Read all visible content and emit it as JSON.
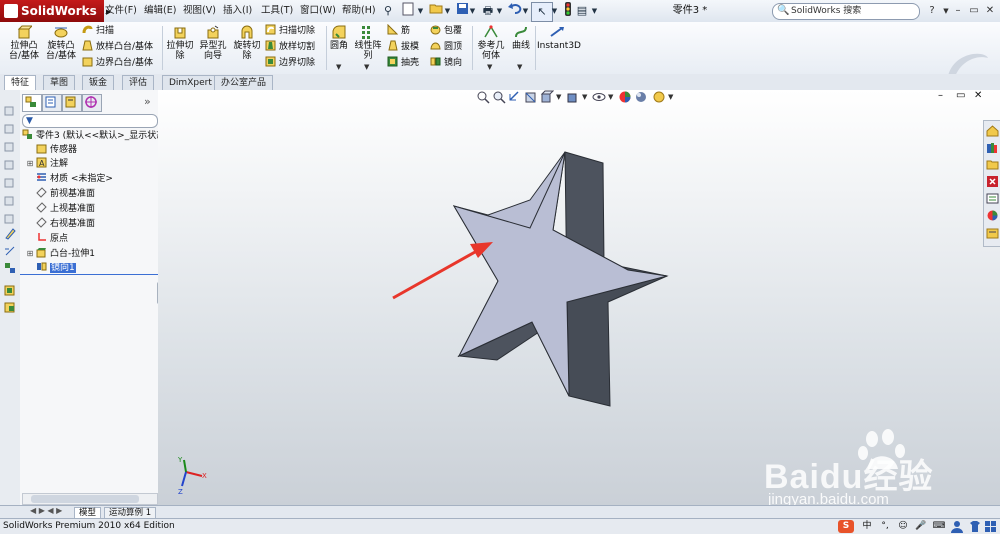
{
  "app": {
    "logo": "SolidWorks",
    "document_title": "零件3 *"
  },
  "menu": [
    "文件(F)",
    "编辑(E)",
    "视图(V)",
    "插入(I)",
    "工具(T)",
    "窗口(W)",
    "帮助(H)"
  ],
  "search": {
    "text": "SolidWorks 搜索"
  },
  "window_buttons": {
    "help": "?",
    "minimize": "–",
    "restore": "▭",
    "close": "✕"
  },
  "features_toolbar": {
    "extrude_boss": "拉伸凸\n台/基体",
    "revolve_boss": "旋转凸\n台/基体",
    "sweep": "扫描",
    "loft_boss": "放样凸台/基体",
    "boundary_boss": "边界凸台/基体",
    "extrude_cut": "拉伸切\n除",
    "hole_wizard": "异型孔\n向导",
    "revolve_cut": "旋转切\n除",
    "sweep_cut": "扫描切除",
    "loft_cut": "放样切割",
    "boundary_cut": "边界切除",
    "fillet": "圆角",
    "linear_pattern": "线性阵\n列",
    "rib": "筋",
    "draft": "拔模",
    "shell": "抽壳",
    "wrap": "包覆",
    "dome": "圆顶",
    "mirror": "镜向",
    "reference_geometry": "参考几\n何体",
    "curves": "曲线",
    "instant3d": "Instant3D"
  },
  "tabs": [
    {
      "label": "特征",
      "active": true
    },
    {
      "label": "草图",
      "active": false
    },
    {
      "label": "钣金",
      "active": false
    },
    {
      "label": "评估",
      "active": false
    },
    {
      "label": "DimXpert",
      "active": false
    },
    {
      "label": "办公室产品",
      "active": false
    }
  ],
  "feature_tree": {
    "root": "零件3 (默认<<默认>_显示状态",
    "items": [
      {
        "label": "传感器",
        "expandable": false,
        "selected": false
      },
      {
        "label": "注解",
        "expandable": true,
        "selected": false
      },
      {
        "label": "材质 <未指定>",
        "expandable": false,
        "selected": false
      },
      {
        "label": "前视基准面",
        "expandable": false,
        "selected": false
      },
      {
        "label": "上视基准面",
        "expandable": false,
        "selected": false
      },
      {
        "label": "右视基准面",
        "expandable": false,
        "selected": false
      },
      {
        "label": "原点",
        "expandable": false,
        "selected": false
      },
      {
        "label": "凸台-拉伸1",
        "expandable": true,
        "selected": false
      },
      {
        "label": "镜向1",
        "expandable": false,
        "selected": true
      }
    ]
  },
  "bottom_tabs": [
    {
      "label": "模型",
      "active": true
    },
    {
      "label": "运动算例 1",
      "active": false
    }
  ],
  "status": {
    "text": "SolidWorks Premium 2010 x64 Edition"
  },
  "ime": {
    "logo": "S",
    "lang": "中",
    "punct": "°,",
    "emoji": "☺",
    "mic": "🎤",
    "keyboard": "⌨"
  },
  "triad": {
    "x": "X",
    "y": "Y",
    "z": "Z"
  },
  "watermark": {
    "brand": "Baidu经验",
    "url": "jingyan.baidu.com"
  },
  "colors": {
    "selection": "#3b6fd4",
    "arrow": "#e8362b",
    "star_face": "#b9bed4",
    "star_side": "#4d535e"
  }
}
